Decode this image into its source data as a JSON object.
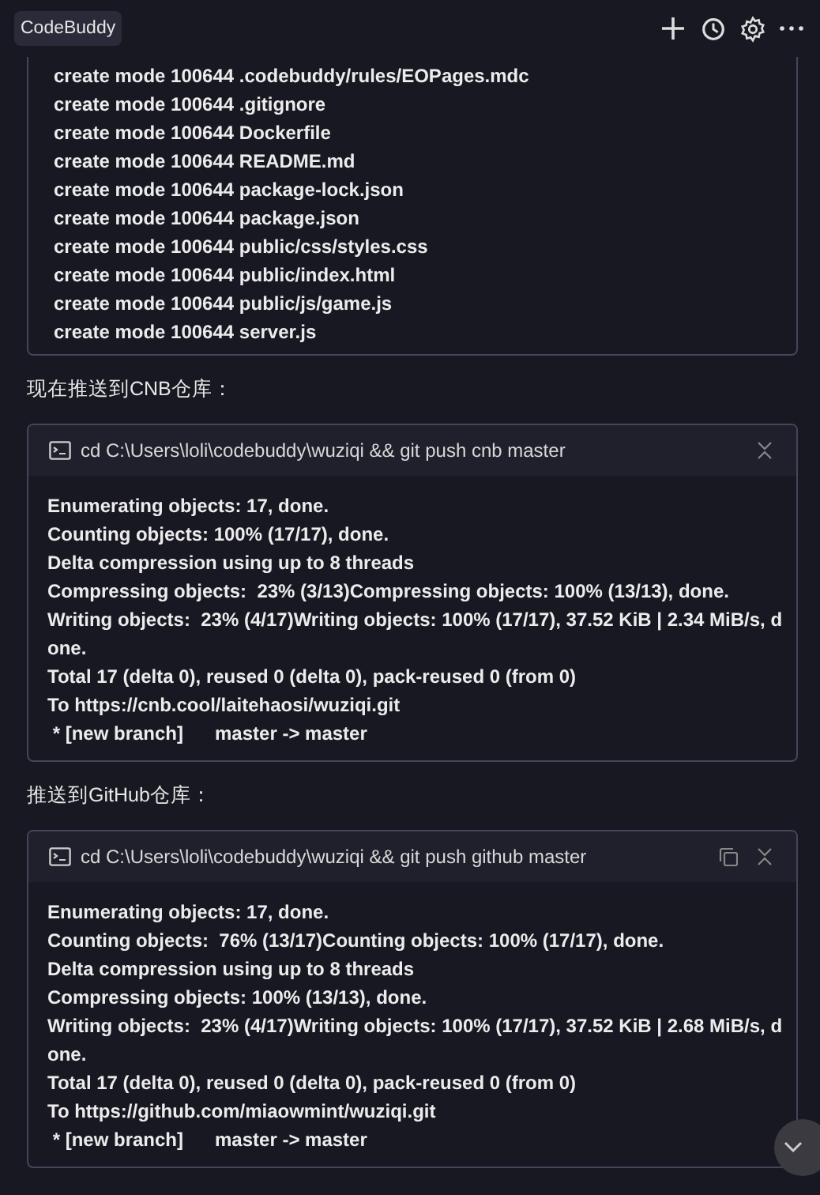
{
  "header": {
    "title": "CodeBuddy"
  },
  "blocks": [
    {
      "kind": "output",
      "lines": [
        "create mode 100644 .codebuddy/rules/EOPages.mdc",
        "create mode 100644 .gitignore",
        "create mode 100644 Dockerfile",
        "create mode 100644 README.md",
        "create mode 100644 package-lock.json",
        "create mode 100644 package.json",
        "create mode 100644 public/css/styles.css",
        "create mode 100644 public/index.html",
        "create mode 100644 public/js/game.js",
        "create mode 100644 server.js"
      ]
    },
    {
      "kind": "text",
      "text": "现在推送到CNB仓库："
    },
    {
      "kind": "terminal",
      "command": "cd C:\\Users\\loli\\codebuddy\\wuziqi && git push cnb master",
      "copy": false,
      "lines": [
        "Enumerating objects: 17, done.",
        "Counting objects: 100% (17/17), done.",
        "Delta compression using up to 8 threads",
        "Compressing objects:  23% (3/13)Compressing objects: 100% (13/13), done.",
        "Writing objects:  23% (4/17)Writing objects: 100% (17/17), 37.52 KiB | 2.34 MiB/s, d",
        "one.",
        "Total 17 (delta 0), reused 0 (delta 0), pack-reused 0 (from 0)",
        "To https://cnb.cool/laitehaosi/wuziqi.git",
        " * [new branch]      master -> master"
      ]
    },
    {
      "kind": "text",
      "text": "推送到GitHub仓库："
    },
    {
      "kind": "terminal",
      "command": "cd C:\\Users\\loli\\codebuddy\\wuziqi && git push github master",
      "copy": true,
      "lines": [
        "Enumerating objects: 17, done.",
        "Counting objects:  76% (13/17)Counting objects: 100% (17/17), done.",
        "Delta compression using up to 8 threads",
        "Compressing objects: 100% (13/13), done.",
        "Writing objects:  23% (4/17)Writing objects: 100% (17/17), 37.52 KiB | 2.68 MiB/s, d",
        "one.",
        "Total 17 (delta 0), reused 0 (delta 0), pack-reused 0 (from 0)",
        "To https://github.com/miaowmint/wuziqi.git",
        " * [new branch]      master -> master"
      ]
    }
  ]
}
